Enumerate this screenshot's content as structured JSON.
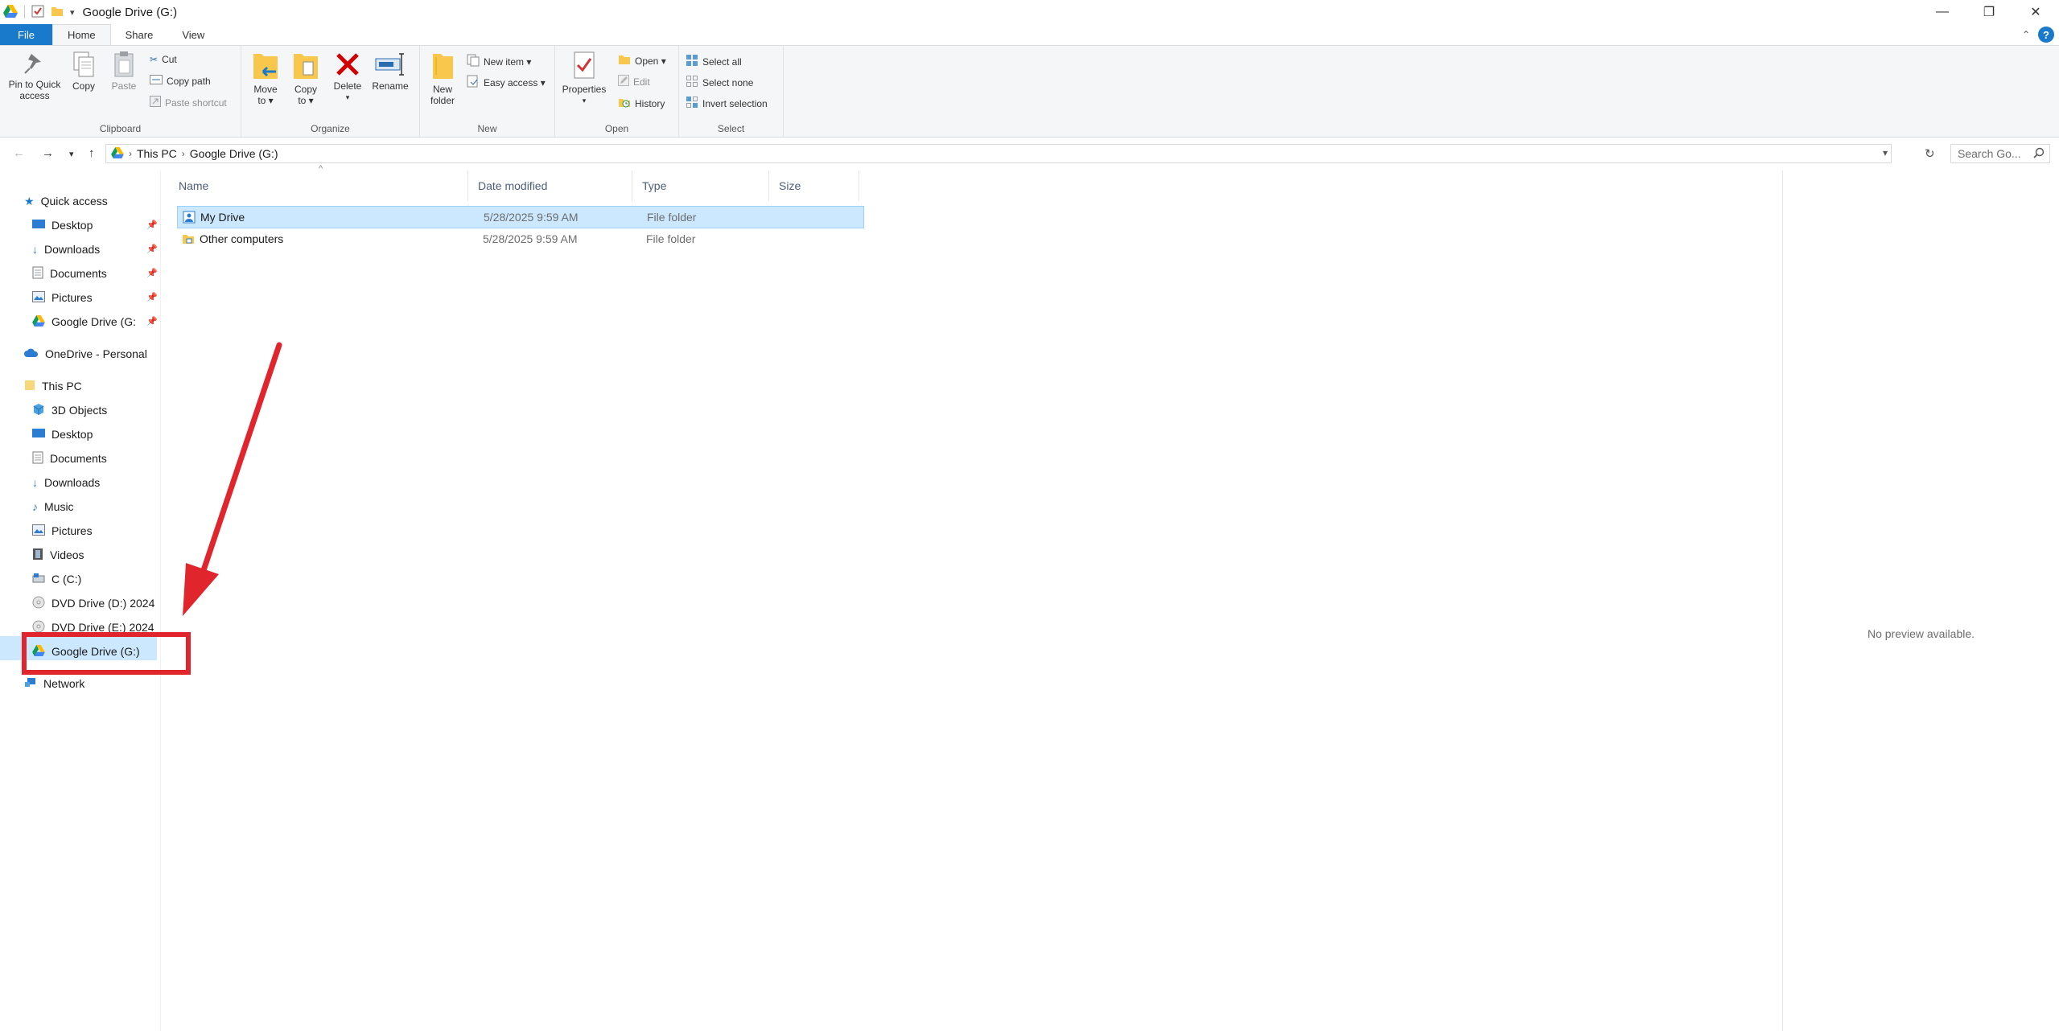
{
  "window": {
    "title": "Google Drive (G:)",
    "minimize": "—",
    "maximize": "❐",
    "close": "✕"
  },
  "tabs": {
    "file": "File",
    "home": "Home",
    "share": "Share",
    "view": "View"
  },
  "ribbon": {
    "clipboard": {
      "label": "Clipboard",
      "pin_line1": "Pin to Quick",
      "pin_line2": "access",
      "copy": "Copy",
      "paste": "Paste",
      "cut": "Cut",
      "copy_path": "Copy path",
      "paste_shortcut": "Paste shortcut"
    },
    "organize": {
      "label": "Organize",
      "move_line1": "Move",
      "move_line2": "to ▾",
      "copy_line1": "Copy",
      "copy_line2": "to ▾",
      "delete": "Delete",
      "rename": "Rename"
    },
    "new": {
      "label": "New",
      "folder_line1": "New",
      "folder_line2": "folder",
      "new_item": "New item ▾",
      "easy_access": "Easy access ▾"
    },
    "open": {
      "label": "Open",
      "properties": "Properties",
      "open": "Open ▾",
      "edit": "Edit",
      "history": "History"
    },
    "select": {
      "label": "Select",
      "select_all": "Select all",
      "select_none": "Select none",
      "invert": "Invert selection"
    }
  },
  "address": {
    "crumbs": [
      "This PC",
      "Google Drive (G:)"
    ],
    "search_placeholder": "Search Go..."
  },
  "nav": {
    "quick_access": "Quick access",
    "qa_items": [
      "Desktop",
      "Downloads",
      "Documents",
      "Pictures",
      "Google Drive (G:"
    ],
    "onedrive": "OneDrive - Personal",
    "this_pc": "This PC",
    "pc_items": [
      "3D Objects",
      "Desktop",
      "Documents",
      "Downloads",
      "Music",
      "Pictures",
      "Videos",
      "C (C:)",
      "DVD Drive (D:) 2024",
      "DVD Drive (E:) 2024",
      "Google Drive (G:)"
    ],
    "network": "Network"
  },
  "columns": {
    "name": "Name",
    "date": "Date modified",
    "type": "Type",
    "size": "Size"
  },
  "files": [
    {
      "name": "My Drive",
      "date": "5/28/2025 9:59 AM",
      "type": "File folder",
      "size": ""
    },
    {
      "name": "Other computers",
      "date": "5/28/2025 9:59 AM",
      "type": "File folder",
      "size": ""
    }
  ],
  "preview": {
    "message": "No preview available."
  },
  "colors": {
    "accent": "#1979ca",
    "selection": "#cce8ff",
    "annotation": "#e0252c"
  }
}
